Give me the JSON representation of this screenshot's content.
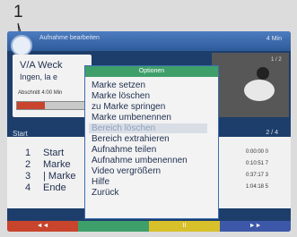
{
  "callout": {
    "number": "1"
  },
  "window": {
    "title": "Aufnahme bearbeiten",
    "title_right": "4 Min"
  },
  "info": {
    "line1": "V/A Weck",
    "line2": "Ingen, la e",
    "small": "Abschnitt 4:00 Min",
    "progress": 0.4
  },
  "preview": {
    "label": "1 / 2"
  },
  "list": {
    "header": "Start",
    "header_right": "2 / 4",
    "marks": [
      {
        "num": "1",
        "label": "Start",
        "time": "0:00:00 0"
      },
      {
        "num": "2",
        "label": "Marke",
        "time": "0:10:51 7"
      },
      {
        "num": "3",
        "label": "| Marke",
        "time": "0:37:17 3"
      },
      {
        "num": "4",
        "label": "Ende",
        "time": "1:04:18 5"
      }
    ]
  },
  "menu": {
    "title": "Optionen",
    "items": [
      {
        "label": "Marke setzen"
      },
      {
        "label": "Marke löschen"
      },
      {
        "label": "zu Marke springen"
      },
      {
        "label": "Marke umbenennen"
      },
      {
        "label": "Bereich löschen",
        "selected": true
      },
      {
        "label": "Bereich extrahieren"
      },
      {
        "label": "Aufnahme teilen"
      },
      {
        "label": "Aufnahme umbenennen"
      },
      {
        "label": "Video vergrößern"
      },
      {
        "label": "Hilfe"
      },
      {
        "label": "Zurück"
      }
    ]
  },
  "keys": [
    {
      "label": "◄◄",
      "color": "#c8442c"
    },
    {
      "label": "",
      "color": "#3e9f6a"
    },
    {
      "label": "II",
      "color": "#d8c02a"
    },
    {
      "label": "►►",
      "color": "#3d58a8"
    }
  ]
}
